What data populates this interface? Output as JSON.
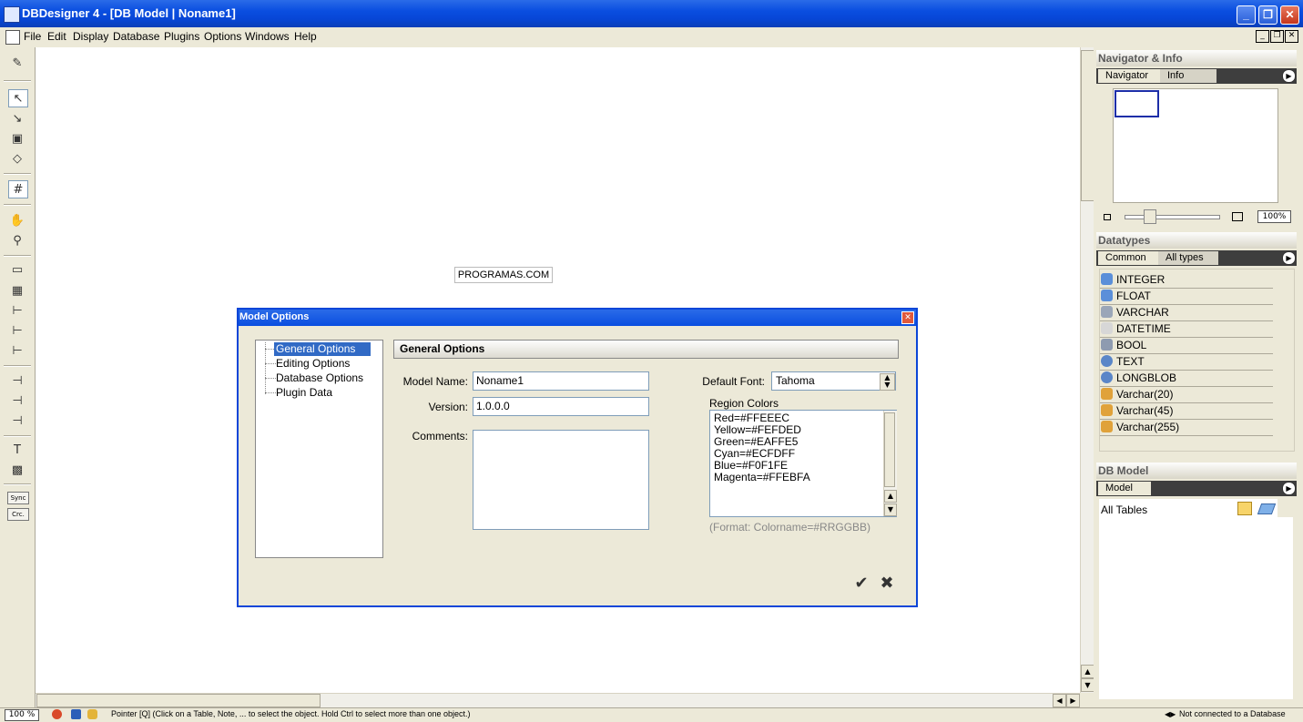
{
  "window": {
    "title": "DBDesigner 4 - [DB Model | Noname1]",
    "min": "_",
    "restore": "❐",
    "close": "✕"
  },
  "menu": {
    "items": [
      "File",
      "Edit",
      "Display",
      "Database",
      "Plugins",
      "Options",
      "Windows",
      "Help"
    ]
  },
  "toolbar": {
    "sync_label": "Sync",
    "crc_label": "Crc."
  },
  "canvas": {
    "watermark": "PROGRAMAS.COM"
  },
  "navigator_panel": {
    "title": "Navigator & Info",
    "tabs": [
      "Navigator",
      "Info"
    ],
    "zoom": "100%"
  },
  "datatypes_panel": {
    "title": "Datatypes",
    "tabs": [
      "Common",
      "All types"
    ],
    "items": [
      "INTEGER",
      "FLOAT",
      "VARCHAR",
      "DATETIME",
      "BOOL",
      "TEXT",
      "LONGBLOB",
      "Varchar(20)",
      "Varchar(45)",
      "Varchar(255)"
    ]
  },
  "model_panel": {
    "title": "DB Model",
    "tabs": [
      "Model"
    ],
    "all_tables": "All Tables"
  },
  "status": {
    "zoom": "100 %",
    "text": "Pointer [Q] (Click on a Table, Note, ... to select the object. Hold Ctrl to select more than one object.)",
    "connection": "Not connected to a Database"
  },
  "dialog": {
    "title": "Model Options",
    "tree": [
      "General Options",
      "Editing Options",
      "Database Options",
      "Plugin Data"
    ],
    "section": "General Options",
    "model_name_label": "Model Name:",
    "model_name_value": "Noname1",
    "version_label": "Version:",
    "version_value": "1.0.0.0",
    "comments_label": "Comments:",
    "default_font_label": "Default Font:",
    "default_font_value": "Tahoma",
    "region_colors_label": "Region Colors",
    "region_colors": [
      "Red=#FFEEEC",
      "Yellow=#FEFDED",
      "Green=#EAFFE5",
      "Cyan=#ECFDFF",
      "Blue=#F0F1FE",
      "Magenta=#FFEBFA"
    ],
    "format_hint": "(Format: Colorname=#RRGGBB)"
  }
}
